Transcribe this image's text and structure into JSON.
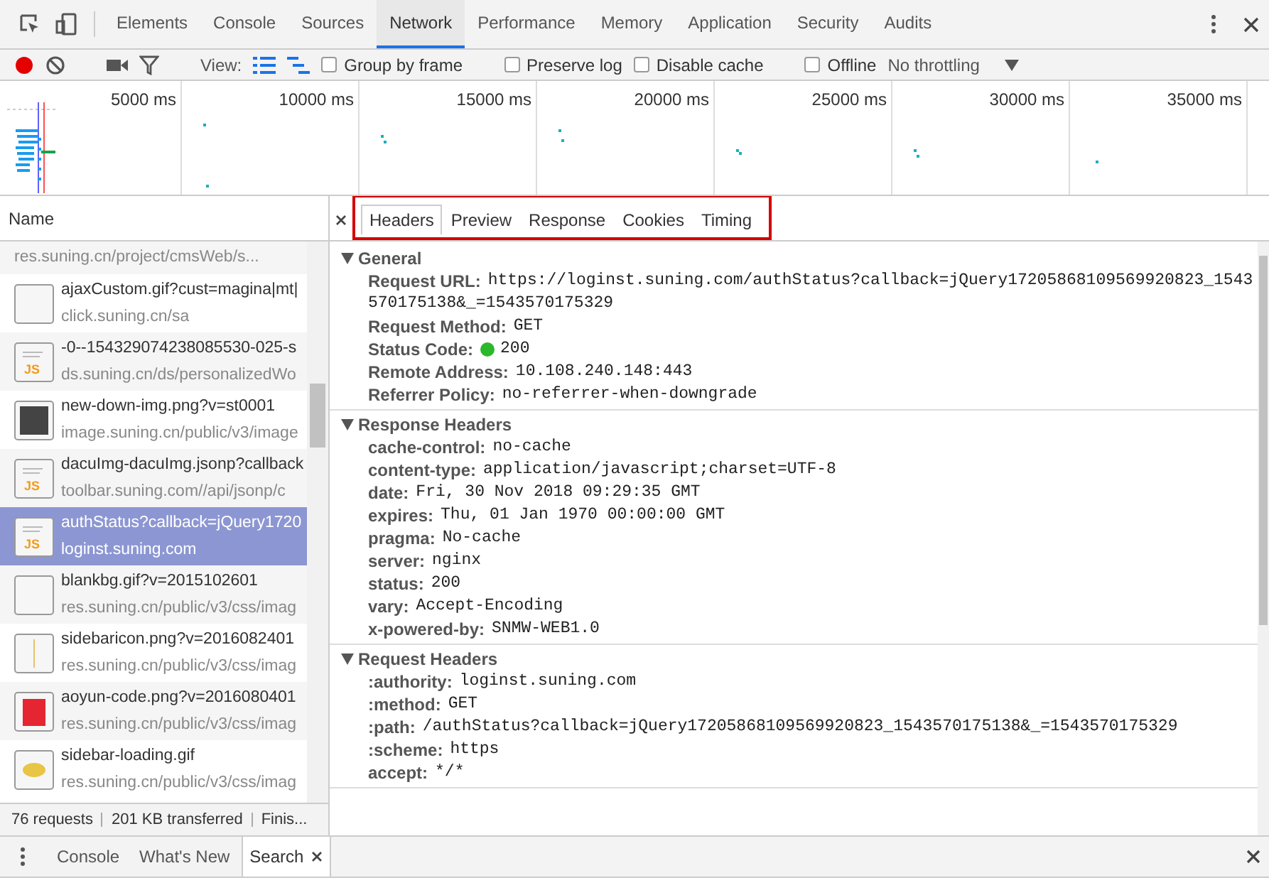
{
  "main_tabs": [
    {
      "label": "Elements",
      "selected": false
    },
    {
      "label": "Console",
      "selected": false
    },
    {
      "label": "Sources",
      "selected": false
    },
    {
      "label": "Network",
      "selected": true
    },
    {
      "label": "Performance",
      "selected": false
    },
    {
      "label": "Memory",
      "selected": false
    },
    {
      "label": "Application",
      "selected": false
    },
    {
      "label": "Security",
      "selected": false
    },
    {
      "label": "Audits",
      "selected": false
    }
  ],
  "toolbar": {
    "recording": true,
    "view_label": "View:",
    "checkboxes": [
      {
        "label": "Group by frame",
        "checked": false
      },
      {
        "label": "Preserve log",
        "checked": false
      },
      {
        "label": "Disable cache",
        "checked": false
      },
      {
        "label": "Offline",
        "checked": false
      }
    ],
    "throttling": "No throttling"
  },
  "overview": {
    "ticks": [
      "5000 ms",
      "10000 ms",
      "15000 ms",
      "20000 ms",
      "25000 ms",
      "30000 ms",
      "35000 ms"
    ]
  },
  "requests": {
    "column": "Name",
    "rows": [
      {
        "kind": "partial",
        "url": "res.suning.cn/project/cmsWeb/s...",
        "selected": false
      },
      {
        "kind": "blank",
        "name": "ajaxCustom.gif?cust=magina|mt|",
        "url": "click.suning.cn/sa",
        "selected": false
      },
      {
        "kind": "script",
        "icon_text": "JS",
        "name": "-0--154329074238085530-025-s",
        "url": "ds.suning.cn/ds/personalizedWo",
        "selected": false
      },
      {
        "kind": "qr",
        "name": "new-down-img.png?v=st0001",
        "url": "image.suning.cn/public/v3/image",
        "selected": false
      },
      {
        "kind": "script",
        "icon_text": "JS",
        "name": "dacuImg-dacuImg.jsonp?callback",
        "url": "toolbar.suning.com//api/jsonp/c",
        "selected": false
      },
      {
        "kind": "script",
        "icon_text": "JS",
        "name": "authStatus?callback=jQuery1720",
        "url": "loginst.suning.com",
        "selected": true
      },
      {
        "kind": "blank",
        "name": "blankbg.gif?v=2015102601",
        "url": "res.suning.cn/public/v3/css/imag",
        "selected": false
      },
      {
        "kind": "bar",
        "name": "sidebaricon.png?v=2016082401",
        "url": "res.suning.cn/public/v3/css/imag",
        "selected": false
      },
      {
        "kind": "bag",
        "name": "aoyun-code.png?v=2016080401",
        "url": "res.suning.cn/public/v3/css/imag",
        "selected": false
      },
      {
        "kind": "loading",
        "name": "sidebar-loading.gif",
        "url": "res.suning.cn/public/v3/css/imag",
        "selected": false
      }
    ]
  },
  "status_bar": [
    "76 requests",
    "201 KB transferred",
    "Finis..."
  ],
  "detail_tabs": [
    {
      "label": "Headers",
      "selected": true
    },
    {
      "label": "Preview",
      "selected": false
    },
    {
      "label": "Response",
      "selected": false
    },
    {
      "label": "Cookies",
      "selected": false
    },
    {
      "label": "Timing",
      "selected": false
    }
  ],
  "sections": [
    {
      "title": "General",
      "expanded": true,
      "rows": [
        {
          "kind": "plain",
          "key": "Request URL:",
          "value": "https://loginst.suning.com/authStatus?callback=jQuery17205868109569920823_1543570175138&_=1543570175329"
        },
        {
          "kind": "plain",
          "key": "Request Method:",
          "value": "GET"
        },
        {
          "kind": "status",
          "key": "Status Code:",
          "value": "200"
        },
        {
          "kind": "plain",
          "key": "Remote Address:",
          "value": "10.108.240.148:443"
        },
        {
          "kind": "plain",
          "key": "Referrer Policy:",
          "value": "no-referrer-when-downgrade"
        }
      ]
    },
    {
      "title": "Response Headers",
      "expanded": true,
      "rows": [
        {
          "kind": "plain",
          "key": "cache-control:",
          "value": "no-cache"
        },
        {
          "kind": "plain",
          "key": "content-type:",
          "value": "application/javascript;charset=UTF-8"
        },
        {
          "kind": "plain",
          "key": "date:",
          "value": "Fri, 30 Nov 2018 09:29:35 GMT"
        },
        {
          "kind": "plain",
          "key": "expires:",
          "value": "Thu, 01 Jan 1970 00:00:00 GMT"
        },
        {
          "kind": "plain",
          "key": "pragma:",
          "value": "No-cache"
        },
        {
          "kind": "plain",
          "key": "server:",
          "value": "nginx"
        },
        {
          "kind": "plain",
          "key": "status:",
          "value": "200"
        },
        {
          "kind": "plain",
          "key": "vary:",
          "value": "Accept-Encoding"
        },
        {
          "kind": "plain",
          "key": "x-powered-by:",
          "value": "SNMW-WEB1.0"
        }
      ]
    },
    {
      "title": "Request Headers",
      "expanded": true,
      "rows": [
        {
          "kind": "plain",
          "key": ":authority:",
          "value": "loginst.suning.com"
        },
        {
          "kind": "plain",
          "key": ":method:",
          "value": "GET"
        },
        {
          "kind": "plain",
          "key": ":path:",
          "value": "/authStatus?callback=jQuery17205868109569920823_1543570175138&_=1543570175329"
        },
        {
          "kind": "plain",
          "key": ":scheme:",
          "value": "https"
        },
        {
          "kind": "plain",
          "key": "accept:",
          "value": "*/*"
        }
      ]
    }
  ],
  "drawer_tabs": [
    {
      "label": "Console",
      "selected": false
    },
    {
      "label": "What's New",
      "selected": false
    },
    {
      "label": "Search",
      "selected": true
    }
  ]
}
